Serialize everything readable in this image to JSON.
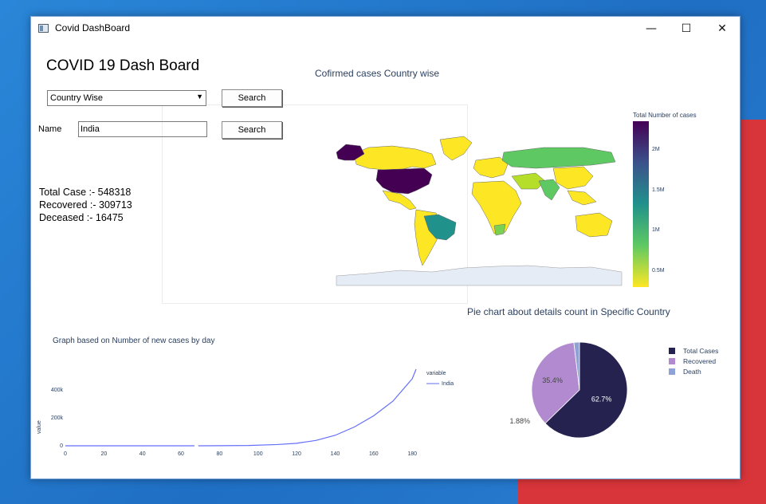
{
  "window": {
    "title": "Covid DashBoard",
    "minimize": "—",
    "maximize": "☐",
    "close": "✕"
  },
  "header": {
    "title": "COVID 19 Dash Board"
  },
  "controls": {
    "mode_select_value": "Country Wise",
    "search_label": "Search",
    "name_label": "Name",
    "name_value": "India",
    "search2_label": "Search"
  },
  "stats": {
    "total": "Total Case :- 548318",
    "recovered": "Recovered :- 309713",
    "deceased": "Deceased :- 16475"
  },
  "map": {
    "title": "Cofirmed cases Country wise",
    "colorbar_title": "Total Number of cases",
    "colorbar_ticks": [
      "2M",
      "1.5M",
      "1M",
      "0.5M"
    ],
    "colors": {
      "high": "#440154",
      "mid": "#21918c",
      "low": "#fde725",
      "green": "#5ec962",
      "ocean": "#e5ecf6"
    }
  },
  "chart_data": [
    {
      "type": "line",
      "title": "Graph based on Number of new cases by day",
      "xlabel": "",
      "ylabel": "value",
      "legend_title": "variable",
      "series": [
        {
          "name": "India",
          "x": [
            0,
            20,
            40,
            67,
            69,
            80,
            95,
            110,
            120,
            130,
            140,
            150,
            160,
            170,
            180,
            182
          ],
          "values": [
            0,
            0,
            0,
            0,
            0,
            500,
            2000,
            9000,
            18000,
            38000,
            75000,
            135000,
            215000,
            320000,
            480000,
            548318
          ]
        }
      ],
      "xticks": [
        0,
        20,
        40,
        60,
        80,
        100,
        120,
        140,
        160,
        180
      ],
      "yticks": [
        "0",
        "200k",
        "400k"
      ],
      "xlim": [
        0,
        182
      ],
      "ylim": [
        0,
        548318
      ],
      "color": "#636efa"
    },
    {
      "type": "pie",
      "title": "Pie chart about details count in Specific Country",
      "categories": [
        "Total Cases",
        "Recovered",
        "Death"
      ],
      "values": [
        62.7,
        35.4,
        1.88
      ],
      "labels": [
        "62.7%",
        "35.4%",
        "1.88%"
      ],
      "colors": [
        "#25224f",
        "#b28ad0",
        "#8ea2d8"
      ]
    }
  ]
}
